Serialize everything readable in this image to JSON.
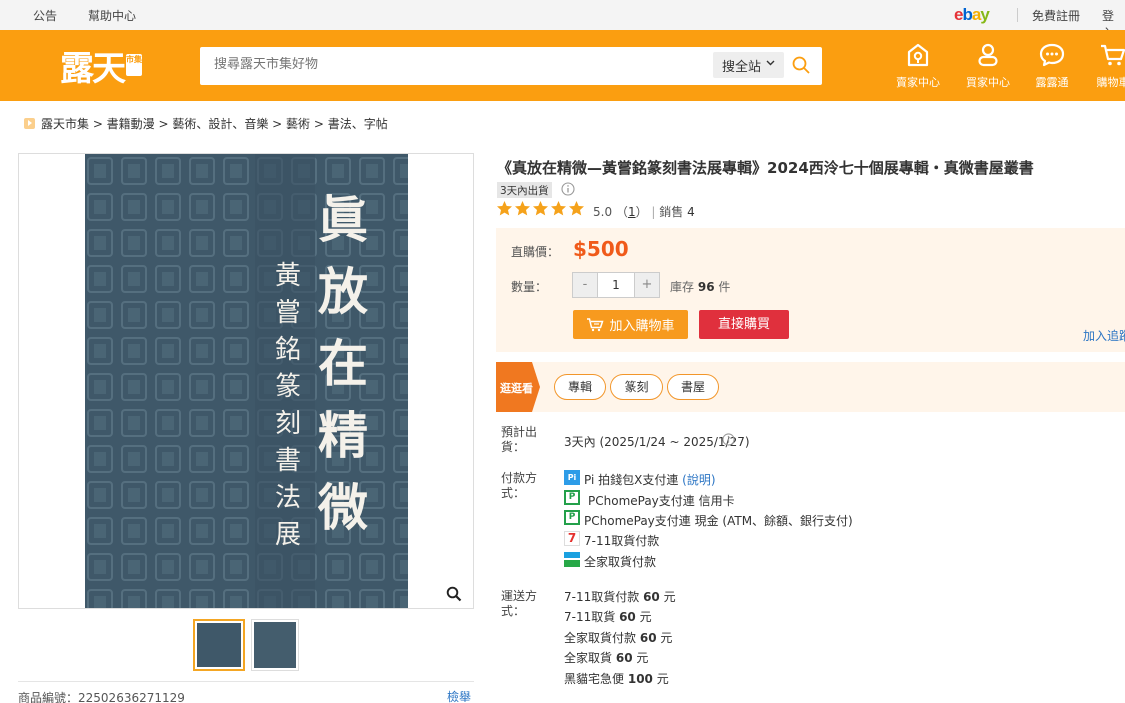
{
  "topbar": {
    "announcement": "公告",
    "help": "幫助中心",
    "ebay": [
      "e",
      "b",
      "a",
      "y"
    ],
    "register": "免費註冊",
    "login": "登入"
  },
  "header": {
    "logo_text": "露天",
    "logo_badge": "市集",
    "search_placeholder": "搜尋露天市集好物",
    "search_scope": "搜全站",
    "seller_center": "賣家中心",
    "buyer_center": "買家中心",
    "lulu_tong": "露露通",
    "cart": "購物車",
    "brand_color": "#fb9e10"
  },
  "breadcrumb": "露天市集 > 書籍動漫 > 藝術、設計、音樂 > 藝術 > 書法、字帖",
  "gallery": {
    "cover_big_text": "眞放在精微",
    "cover_sub_text": "黃嘗銘篆刻書法展",
    "product_no_label": "商品編號：",
    "product_no": "22502636271129",
    "report": "檢舉"
  },
  "product": {
    "title": "《真放在精微—黃嘗銘篆刻書法展專輯》2024西泠七十個展專輯・真微書屋叢書",
    "ship_badge": "3天內出貨",
    "rating_value": 5.0,
    "rating_score": "5.0",
    "rating_open": "（",
    "rating_count": "1",
    "rating_close": "）",
    "sold_label": "銷售",
    "sold_count": "4",
    "price_label": "直購價：",
    "price": "$500",
    "qty_label": "數量：",
    "qty_minus": "-",
    "qty_value": "1",
    "qty_plus": "+",
    "stock_label": "庫存",
    "stock_count": "96",
    "stock_unit": "件",
    "add_cart": "加入購物車",
    "buy_now": "直接購買",
    "follow": "加入追蹤"
  },
  "tags": {
    "ribbon": "逛逛看",
    "items": [
      "專輯",
      "篆刻",
      "書屋"
    ]
  },
  "delivery": {
    "label": "預計出貨：",
    "value": "3天內 (2025/1/24 ~ 2025/1/27)"
  },
  "payment": {
    "label": "付款方式：",
    "items": [
      {
        "icon": "Pi",
        "text": "Pi 拍錢包X支付連",
        "link": "(說明)"
      },
      {
        "icon": "P",
        "text": "PChomePay支付連 信用卡"
      },
      {
        "icon": "P",
        "text": "PChomePay支付連 現金 (ATM、餘額、銀行支付)"
      },
      {
        "icon": "7",
        "text": "7-11取貨付款"
      },
      {
        "icon": "F",
        "text": "全家取貨付款"
      }
    ]
  },
  "shipping": {
    "label": "運送方式：",
    "items": [
      {
        "name": "7-11取貨付款",
        "fee": "60",
        "unit": "元"
      },
      {
        "name": "7-11取貨",
        "fee": "60",
        "unit": "元"
      },
      {
        "name": "全家取貨付款",
        "fee": "60",
        "unit": "元"
      },
      {
        "name": "全家取貨",
        "fee": "60",
        "unit": "元"
      },
      {
        "name": "黑貓宅急便",
        "fee": "100",
        "unit": "元"
      }
    ]
  }
}
